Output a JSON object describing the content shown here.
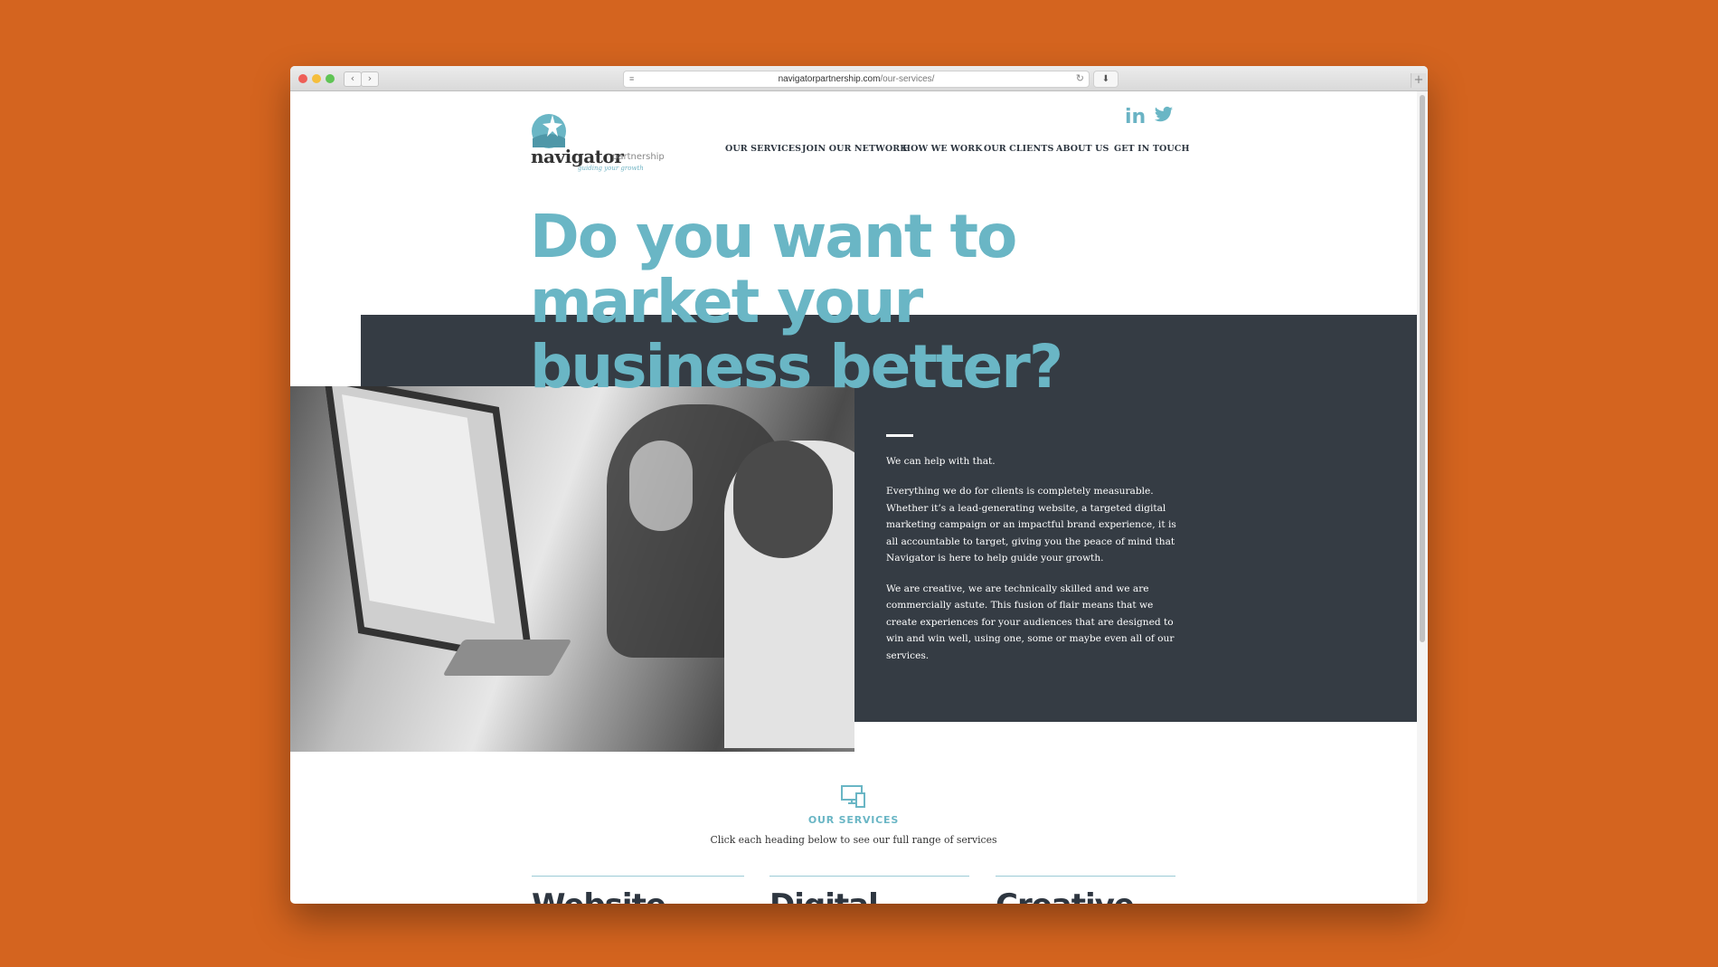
{
  "browser": {
    "url_domain": "navigatorpartnership.com",
    "url_path": "/our-services/",
    "back_symbol": "‹",
    "forward_symbol": "›",
    "menu_symbol": "≡",
    "reload_symbol": "↻",
    "download_symbol": "⬇",
    "new_tab_symbol": "+"
  },
  "logo": {
    "name": "navigator",
    "suffix": "partnership",
    "tagline": "guiding your growth"
  },
  "social": {
    "linkedin": "in"
  },
  "nav": {
    "items": [
      {
        "label": "OUR SERVICES",
        "active": true
      },
      {
        "label": "JOIN OUR NETWORK"
      },
      {
        "label": "HOW WE WORK"
      },
      {
        "label": "OUR CLIENTS"
      },
      {
        "label": "ABOUT US"
      },
      {
        "label": "GET IN TOUCH"
      }
    ]
  },
  "hero": {
    "headline_line1": "Do you want to",
    "headline_line2": "market your",
    "headline_line3": "business better?",
    "intro": "We can help with that.",
    "paragraph1": "Everything we do for clients is completely measurable. Whether it’s a lead-generating website, a targeted digital marketing campaign or an impactful brand experience, it is all accountable to target, giving you the peace of mind that Navigator is here to help guide your growth.",
    "paragraph2": "We are creative, we are technically skilled and we are commercially astute. This fusion of flair means that we create experiences for your audiences that are designed to win and win well, using one, some or maybe even all of our services."
  },
  "services": {
    "title": "OUR SERVICES",
    "subtitle": "Click each heading below to see our full range of services",
    "columns": [
      {
        "heading": "Website"
      },
      {
        "heading": "Digital"
      },
      {
        "heading": "Creative"
      }
    ]
  },
  "colors": {
    "background": "#d4641f",
    "accent": "#6ab6c5",
    "dark_panel": "#353c44",
    "text_dark": "#2d3640"
  }
}
